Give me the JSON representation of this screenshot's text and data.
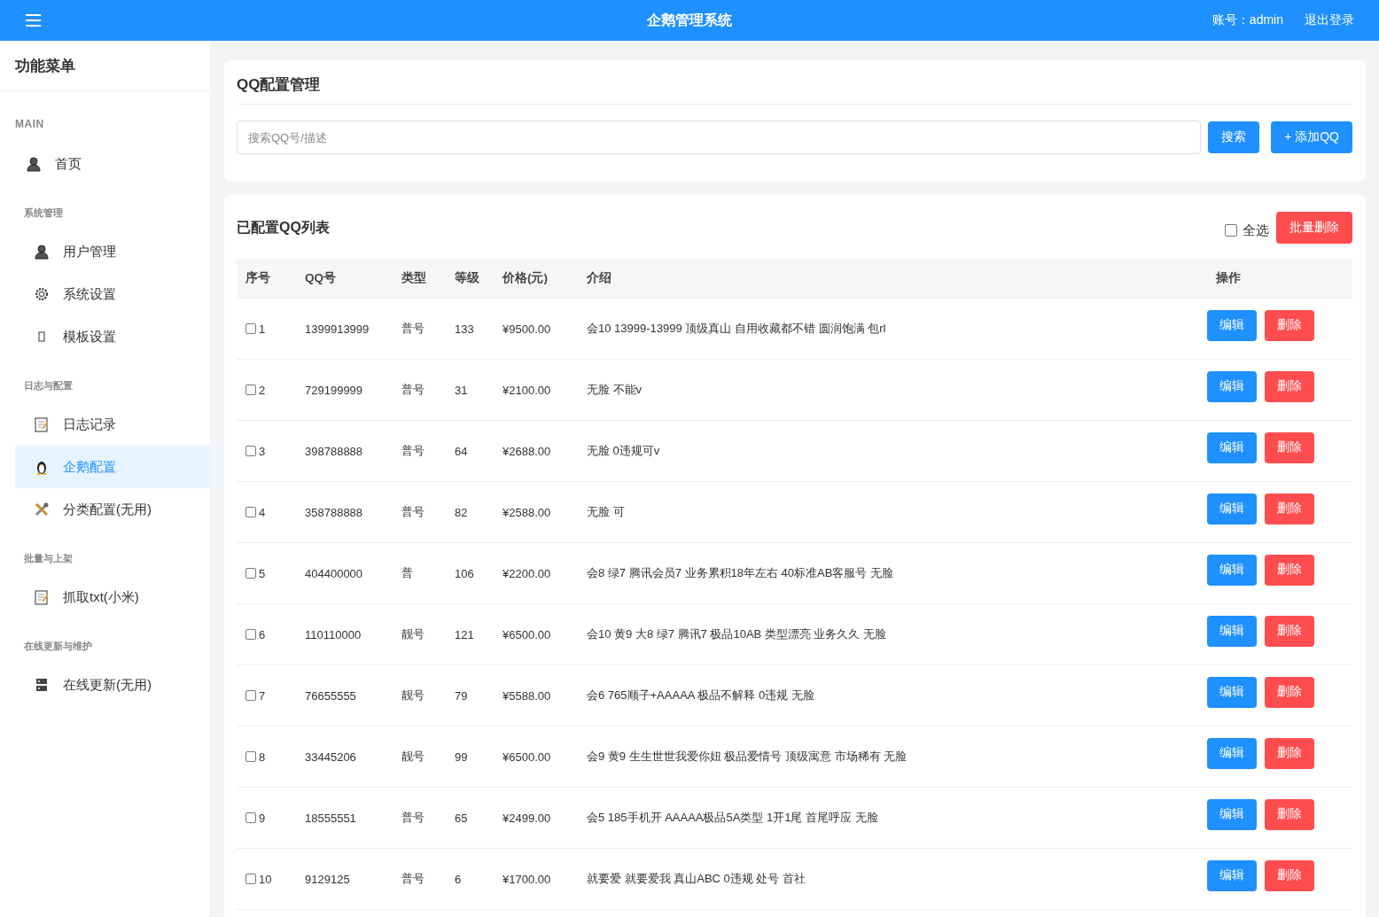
{
  "header": {
    "title": "企鹅管理系统",
    "account": "账号：admin",
    "logout": "退出登录"
  },
  "sidebar": {
    "title": "功能菜单",
    "sections": [
      {
        "kind": "main",
        "label": "MAIN",
        "items": [
          {
            "label": "首页",
            "selected": false
          }
        ]
      },
      {
        "kind": "group",
        "label": "系统管理",
        "items": [
          {
            "label": "用户管理",
            "selected": false
          },
          {
            "label": "系统设置",
            "selected": false
          },
          {
            "label": "模板设置",
            "selected": false
          }
        ]
      },
      {
        "kind": "group",
        "label": "日志与配置",
        "items": [
          {
            "label": "日志记录",
            "selected": false
          },
          {
            "label": "企鹅配置",
            "selected": true
          },
          {
            "label": "分类配置(无用)",
            "selected": false
          }
        ]
      },
      {
        "kind": "group",
        "label": "批量与上架",
        "items": [
          {
            "label": "抓取txt(小米)",
            "selected": false
          }
        ]
      },
      {
        "kind": "group",
        "label": "在线更新与维护",
        "items": [
          {
            "label": "在线更新(无用)",
            "selected": false
          }
        ]
      }
    ]
  },
  "config": {
    "title": "QQ配置管理",
    "search": {
      "placeholder": "搜索QQ号/描述"
    },
    "search_button": "搜索",
    "add_button": "+ 添加QQ"
  },
  "list": {
    "title": "已配置QQ列表",
    "select_all": {
      "label": "全选",
      "checked": false
    },
    "batch_delete": "批量删除",
    "columns": [
      "序号",
      "QQ号",
      "类型",
      "等级",
      "价格(元)",
      "介绍",
      "操作"
    ],
    "rows": [
      {
        "index": "1",
        "checked": false,
        "qq": "1399913999",
        "type": "普号",
        "level": "133",
        "price": "¥9500.00",
        "intro": "会10 13999-13999 顶级真山 自用收藏都不错 圆润饱满 包rl",
        "actions": [
          "编辑",
          "删除"
        ]
      },
      {
        "index": "2",
        "checked": false,
        "qq": "729199999",
        "type": "普号",
        "level": "31",
        "price": "¥2100.00",
        "intro": "无脸 不能v",
        "actions": [
          "编辑",
          "删除"
        ]
      },
      {
        "index": "3",
        "checked": false,
        "qq": "398788888",
        "type": "普号",
        "level": "64",
        "price": "¥2688.00",
        "intro": "无脸 0违规可v",
        "actions": [
          "编辑",
          "删除"
        ]
      },
      {
        "index": "4",
        "checked": false,
        "qq": "358788888",
        "type": "普号",
        "level": "82",
        "price": "¥2588.00",
        "intro": "无脸 可",
        "actions": [
          "编辑",
          "删除"
        ]
      },
      {
        "index": "5",
        "checked": false,
        "qq": "404400000",
        "type": "普",
        "level": "106",
        "price": "¥2200.00",
        "intro": "会8 绿7 腾讯会员7 业务累积18年左右 40标准AB客服号 无脸",
        "actions": [
          "编辑",
          "删除"
        ]
      },
      {
        "index": "6",
        "checked": false,
        "qq": "110110000",
        "type": "靓号",
        "level": "121",
        "price": "¥6500.00",
        "intro": "会10 黄9 大8 绿7 腾讯7 极品10AB 类型漂亮 业务久久 无脸",
        "actions": [
          "编辑",
          "删除"
        ]
      },
      {
        "index": "7",
        "checked": false,
        "qq": "76655555",
        "type": "靓号",
        "level": "79",
        "price": "¥5588.00",
        "intro": "会6 765顺子+AAAAA 极品不解释 0违规 无脸",
        "actions": [
          "编辑",
          "删除"
        ]
      },
      {
        "index": "8",
        "checked": false,
        "qq": "33445206",
        "type": "靓号",
        "level": "99",
        "price": "¥6500.00",
        "intro": "会9 黄9 生生世世我爱你妞 极品爱情号 顶级寓意 市场稀有 无脸",
        "actions": [
          "编辑",
          "删除"
        ]
      },
      {
        "index": "9",
        "checked": false,
        "qq": "18555551",
        "type": "普号",
        "level": "65",
        "price": "¥2499.00",
        "intro": "会5 185手机开 AAAAA极品5A类型 1开1尾 首尾呼应 无脸",
        "actions": [
          "编辑",
          "删除"
        ]
      },
      {
        "index": "10",
        "checked": false,
        "qq": "9129125",
        "type": "普号",
        "level": "6",
        "price": "¥1700.00",
        "intro": "就要爱 就要爱我 真山ABC 0违规 处号 首社",
        "actions": [
          "编辑",
          "删除"
        ]
      }
    ]
  }
}
